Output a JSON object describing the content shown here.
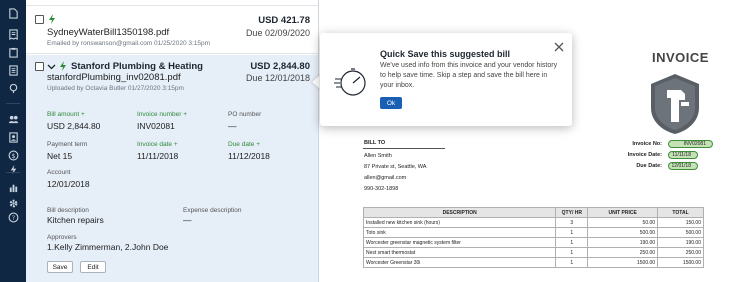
{
  "rail": {
    "icons": [
      "document-icon",
      "receipt-icon",
      "clipboard-icon",
      "list-icon",
      "location-pin-icon",
      "users-icon",
      "person-icon",
      "dollar-icon",
      "lightning-icon",
      "bar-chart-icon",
      "gear-icon",
      "help-icon"
    ]
  },
  "bills": [
    {
      "file": "SydneyWaterBill1350198.pdf",
      "amount": "USD 421.78",
      "due": "Due 02/09/2020",
      "meta": "Emailed by ronswanson@gmail.com 01/25/2020 3:15pm"
    },
    {
      "vendor": "Stanford Plumbing & Heating",
      "file": "stanfordPlumbing_inv02081.pdf",
      "amount": "USD 2,844.80",
      "due": "Due 12/01/2018",
      "meta": "Uploaded by Octavia Butler 01/27/2020 3:15pm"
    }
  ],
  "details": {
    "bill_amount_label": "Bill amount",
    "bill_amount_value": "USD 2,844.80",
    "invoice_number_label": "Invoice number",
    "invoice_number_value": "INV02081",
    "po_number_label": "PO number",
    "po_number_value": "—",
    "payment_term_label": "Payment term",
    "payment_term_value": "Net 15",
    "invoice_date_label": "Invoice date",
    "invoice_date_value": "11/11/2018",
    "due_date_label": "Due date",
    "due_date_value": "11/12/2018",
    "account_label": "Account",
    "account_value": "12/01/2018",
    "bill_description_label": "Bill description",
    "bill_description_value": "Kitchen repairs",
    "expense_description_label": "Expense description",
    "expense_description_value": "—",
    "approvers_label": "Approvers",
    "approvers_value": "1.Kelly Zimmerman, 2.John Doe",
    "save_label": "Save",
    "edit_label": "Edit",
    "suggested_marker": "+"
  },
  "popover": {
    "title": "Quick Save this suggested bill",
    "body": "We've used info from this invoice and your vendor history to help save time. Skip a step and save the bill here in your inbox.",
    "ok_label": "Ok"
  },
  "invoice": {
    "title": "INVOICE",
    "bill_to_label": "BILL TO",
    "bill_to_lines": [
      "Allen Smith",
      "87 Private st, Seattle, WA",
      "allen@gmail.com",
      "990-302-1898"
    ],
    "invoice_no_label": "Invoice No:",
    "invoice_no_value": "INV02081",
    "invoice_date_label": "Invoice Date:",
    "invoice_date_value": "11/11/18",
    "due_date_label": "Due Date:",
    "due_date_value": "12/01/18",
    "table_headers": [
      "DESCRIPTION",
      "QTY/ HR",
      "UNIT PRICE",
      "TOTAL"
    ],
    "table_rows": [
      [
        "Installed new kitchen sink (hours)",
        "3",
        "50.00",
        "150.00"
      ],
      [
        "Toto sink",
        "1",
        "500.00",
        "500.00"
      ],
      [
        "Worcester greenstar magnetic system filter",
        "1",
        "190.00",
        "190.00"
      ],
      [
        "Nest smart thermostat",
        "1",
        "250.00",
        "250.00"
      ],
      [
        "Worcester Greenstar 30i",
        "1",
        "1500.00",
        "1500.00"
      ]
    ]
  },
  "colors": {
    "rail": "#0f2742",
    "selected_bill": "#e6eef8",
    "accent_blue": "#1a5fb4",
    "suggested_green": "#2f8a3a",
    "highlight_green": "#c4e2b5"
  }
}
